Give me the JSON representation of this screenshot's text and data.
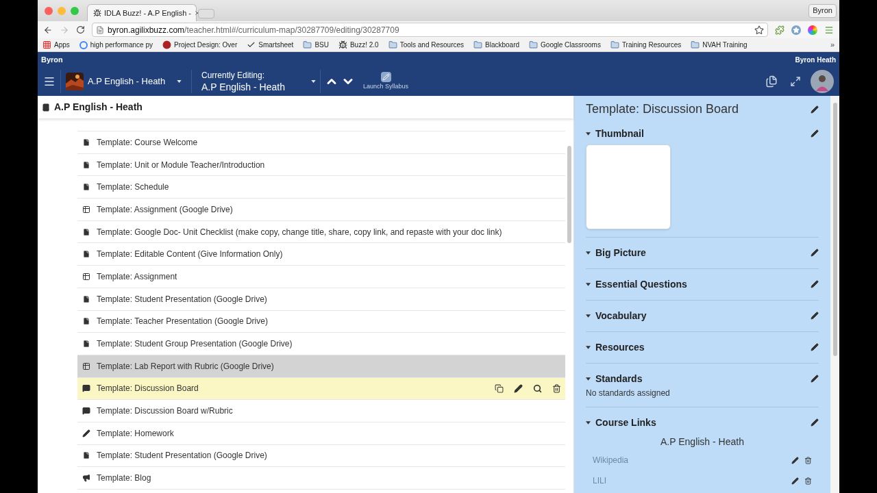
{
  "browser": {
    "tab_title": "IDLA Buzz! - A.P English -",
    "profile_button": "Byron",
    "url_host": "byron.agilixbuzz.com",
    "url_path": "/teacher.html#/curriculum-map/30287709/editing/30287709",
    "bookmarks": [
      {
        "label": "Apps",
        "kind": "apps"
      },
      {
        "label": "high performance py",
        "kind": "google"
      },
      {
        "label": "Project Design: Over",
        "kind": "site"
      },
      {
        "label": "Smartsheet",
        "kind": "check"
      },
      {
        "label": "BSU",
        "kind": "folder"
      },
      {
        "label": "Buzz! 2.0",
        "kind": "bee"
      },
      {
        "label": "Tools and Resources",
        "kind": "folder"
      },
      {
        "label": "Blackboard",
        "kind": "folder"
      },
      {
        "label": "Google Classrooms",
        "kind": "folder"
      },
      {
        "label": "Training Resources",
        "kind": "folder"
      },
      {
        "label": "NVAH Training",
        "kind": "folder"
      }
    ],
    "more": "»"
  },
  "app": {
    "user_short": "Byron",
    "user_full": "Byron Heath",
    "course": "A.P English - Heath",
    "editing_label": "Currently Editing:",
    "editing_course": "A.P English - Heath",
    "launch": "Launch Syllabus"
  },
  "outline": {
    "title": "A.P English - Heath",
    "items": [
      {
        "label": "Template: Course Welcome",
        "kind": "page",
        "selected": false,
        "hovered": false
      },
      {
        "label": "Template: Unit or Module Teacher/Introduction",
        "kind": "page",
        "selected": false,
        "hovered": false
      },
      {
        "label": "Template: Schedule",
        "kind": "page",
        "selected": false,
        "hovered": false
      },
      {
        "label": "Template: Assignment (Google Drive)",
        "kind": "assignment",
        "selected": false,
        "hovered": false
      },
      {
        "label": "Template: Google Doc- Unit Checklist (make copy, change title, share, copy link, and repaste with your doc link)",
        "kind": "page",
        "selected": false,
        "hovered": false
      },
      {
        "label": "Template: Editable Content (Give Information Only)",
        "kind": "page",
        "selected": false,
        "hovered": false
      },
      {
        "label": "Template: Assignment",
        "kind": "assignment",
        "selected": false,
        "hovered": false
      },
      {
        "label": "Template: Student Presentation (Google Drive)",
        "kind": "page",
        "selected": false,
        "hovered": false
      },
      {
        "label": "Template: Teacher Presentation (Google Drive)",
        "kind": "page",
        "selected": false,
        "hovered": false
      },
      {
        "label": "Template: Student Group Presentation (Google Drive)",
        "kind": "page",
        "selected": false,
        "hovered": false
      },
      {
        "label": "Template: Lab Report with Rubric (Google Drive)",
        "kind": "assignment",
        "selected": false,
        "hovered": true
      },
      {
        "label": "Template: Discussion Board",
        "kind": "discussion",
        "selected": true,
        "hovered": false
      },
      {
        "label": "Template: Discussion Board w/Rubric",
        "kind": "discussion",
        "selected": false,
        "hovered": false
      },
      {
        "label": "Template: Homework",
        "kind": "homework",
        "selected": false,
        "hovered": false
      },
      {
        "label": "Template: Student Presentation (Google Drive)",
        "kind": "page",
        "selected": false,
        "hovered": false
      },
      {
        "label": "Template: Blog",
        "kind": "blog",
        "selected": false,
        "hovered": false
      }
    ]
  },
  "details": {
    "title": "Template: Discussion Board",
    "sections": [
      {
        "title": "Thumbnail",
        "kind": "thumbnail",
        "expanded": true
      },
      {
        "title": "Big Picture",
        "kind": "plain",
        "expanded": true
      },
      {
        "title": "Essential Questions",
        "kind": "plain",
        "expanded": true
      },
      {
        "title": "Vocabulary",
        "kind": "plain",
        "expanded": true
      },
      {
        "title": "Resources",
        "kind": "plain",
        "expanded": true
      },
      {
        "title": "Standards",
        "kind": "note",
        "expanded": true,
        "note": "No standards assigned"
      },
      {
        "title": "Course Links",
        "kind": "links",
        "expanded": true,
        "course": "A.P English - Heath",
        "links": [
          "Wikipedia",
          "LILI"
        ]
      }
    ]
  }
}
